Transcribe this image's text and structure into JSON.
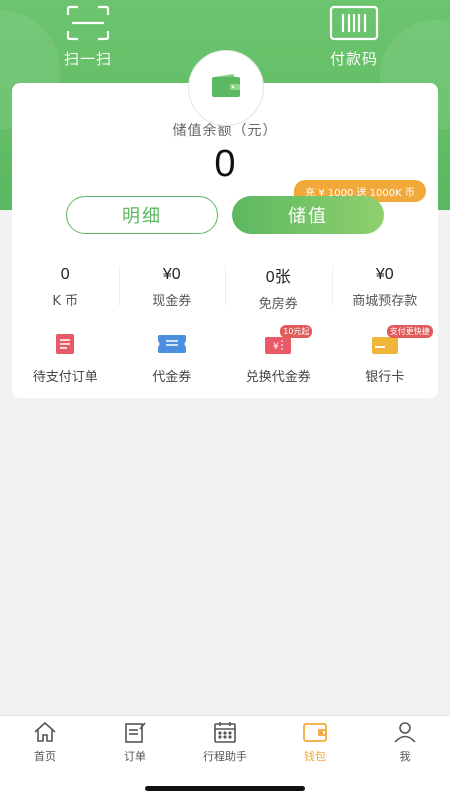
{
  "header": {
    "scan_label": "扫一扫",
    "pay_code_label": "付款码"
  },
  "balance": {
    "label": "储值余额（元）",
    "value": "0"
  },
  "promo": {
    "text": "充 ¥ 1000 送 1000K 币"
  },
  "actions": {
    "detail_label": "明细",
    "recharge_label": "储值"
  },
  "stats": [
    {
      "value": "0",
      "label": "K 币"
    },
    {
      "value": "¥0",
      "label": "现金券"
    },
    {
      "value": "0张",
      "label": "免房券"
    },
    {
      "value": "¥0",
      "label": "商城预存款"
    }
  ],
  "quick": [
    {
      "label": "待支付订单",
      "icon": "order-doc-icon",
      "color": "#e85a68"
    },
    {
      "label": "代金券",
      "icon": "coupon-icon",
      "color": "#4a8fe0",
      "tag": ""
    },
    {
      "label": "兑换代金券",
      "icon": "exchange-coupon-icon",
      "color": "#e85a68",
      "tag": "10元起"
    },
    {
      "label": "银行卡",
      "icon": "bank-card-icon",
      "color": "#f1b53a",
      "tag": "支付更快捷"
    }
  ],
  "tabs": [
    {
      "label": "首页",
      "icon": "home-icon"
    },
    {
      "label": "订单",
      "icon": "order-icon"
    },
    {
      "label": "行程助手",
      "icon": "calendar-icon"
    },
    {
      "label": "钱包",
      "icon": "wallet-icon",
      "active": true
    },
    {
      "label": "我",
      "icon": "user-icon"
    }
  ],
  "colors": {
    "primary_green": "#5cb860",
    "accent_orange": "#f1a93a"
  }
}
